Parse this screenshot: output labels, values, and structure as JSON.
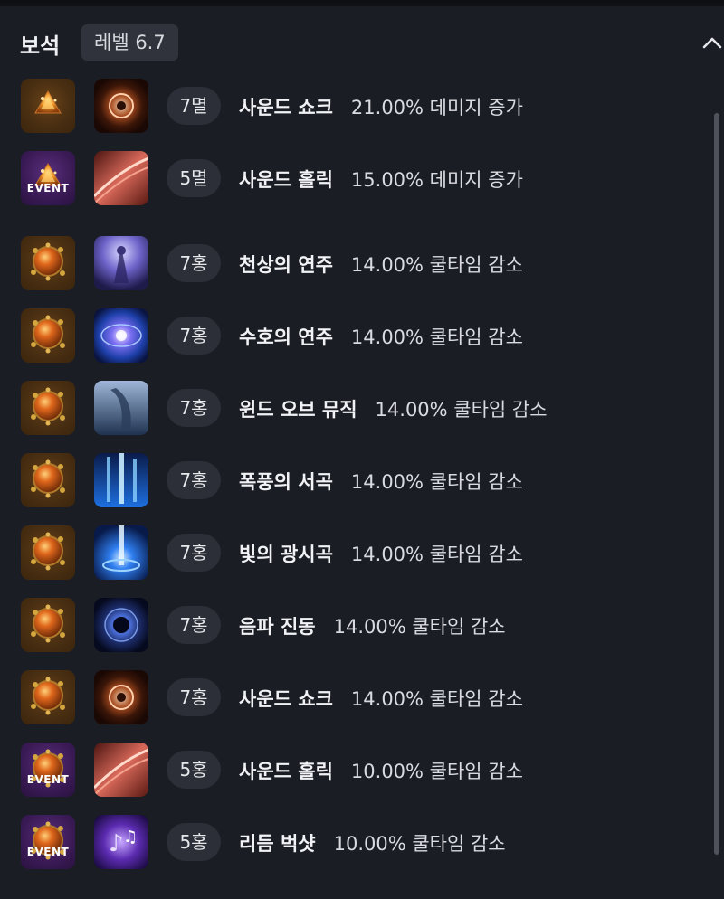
{
  "header": {
    "title": "보석",
    "level_label": "레벨 6.7"
  },
  "colors": {
    "background": "#1b1d24",
    "badge": "#30333b",
    "tier_pill": "#2c2f37"
  },
  "gems": [
    {
      "gem_icon": "flame-gem-icon",
      "gem_event": false,
      "skill_icon": "sound-shock-icon",
      "tier": "7멸",
      "skill": "사운드 쇼크",
      "effect": "21.00% 데미지 증가"
    },
    {
      "gem_icon": "flame-gem-event-icon",
      "gem_event": true,
      "event_label": "EVENT",
      "skill_icon": "sound-holic-icon",
      "tier": "5멸",
      "skill": "사운드 홀릭",
      "effect": "15.00% 데미지 증가"
    },
    {
      "gem_icon": "orange-gem-icon",
      "gem_event": false,
      "skill_icon": "heavenly-tune-icon",
      "tier": "7홍",
      "skill": "천상의 연주",
      "effect": "14.00% 쿨타임 감소"
    },
    {
      "gem_icon": "orange-gem-icon",
      "gem_event": false,
      "skill_icon": "guardian-tune-icon",
      "tier": "7홍",
      "skill": "수호의 연주",
      "effect": "14.00% 쿨타임 감소"
    },
    {
      "gem_icon": "orange-gem-icon",
      "gem_event": false,
      "skill_icon": "wind-of-music-icon",
      "tier": "7홍",
      "skill": "윈드 오브 뮤직",
      "effect": "14.00% 쿨타임 감소"
    },
    {
      "gem_icon": "orange-gem-icon",
      "gem_event": false,
      "skill_icon": "storm-prelude-icon",
      "tier": "7홍",
      "skill": "폭풍의 서곡",
      "effect": "14.00% 쿨타임 감소"
    },
    {
      "gem_icon": "orange-gem-icon",
      "gem_event": false,
      "skill_icon": "rhapsody-of-light-icon",
      "tier": "7홍",
      "skill": "빛의 광시곡",
      "effect": "14.00% 쿨타임 감소"
    },
    {
      "gem_icon": "orange-gem-icon",
      "gem_event": false,
      "skill_icon": "sonic-vibration-icon",
      "tier": "7홍",
      "skill": "음파 진동",
      "effect": "14.00% 쿨타임 감소"
    },
    {
      "gem_icon": "orange-gem-icon",
      "gem_event": false,
      "skill_icon": "sound-shock-icon",
      "tier": "7홍",
      "skill": "사운드 쇼크",
      "effect": "14.00% 쿨타임 감소"
    },
    {
      "gem_icon": "orange-gem-event-icon",
      "gem_event": true,
      "event_label": "EVENT",
      "skill_icon": "sound-holic-icon",
      "tier": "5홍",
      "skill": "사운드 홀릭",
      "effect": "10.00% 쿨타임 감소"
    },
    {
      "gem_icon": "orange-gem-event-icon",
      "gem_event": true,
      "event_label": "EVENT",
      "skill_icon": "rhythm-buckshot-icon",
      "tier": "5홍",
      "skill": "리듬 벅샷",
      "effect": "10.00% 쿨타임 감소"
    }
  ]
}
